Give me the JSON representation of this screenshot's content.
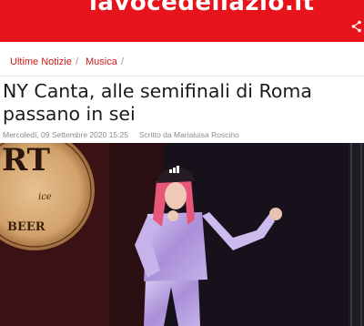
{
  "site": {
    "logo_text": "lavocedellazio.it",
    "brand_color": "#e8141c"
  },
  "header": {
    "share_icon": "share-icon"
  },
  "breadcrumb": {
    "items": [
      "Ultime Notizie",
      "Musica"
    ],
    "separator": "/"
  },
  "article": {
    "title_line1": "NY Canta, alle semifinali di Roma",
    "title_line2": "passano in sei",
    "date": "Mercoledì, 09 Settembre 2020 15:25",
    "author": "Scritto da Marialuisa Roscino"
  },
  "photo": {
    "sign_text": [
      "RT",
      "ice",
      "BEER"
    ],
    "cap_logo": "adidas-logo"
  }
}
